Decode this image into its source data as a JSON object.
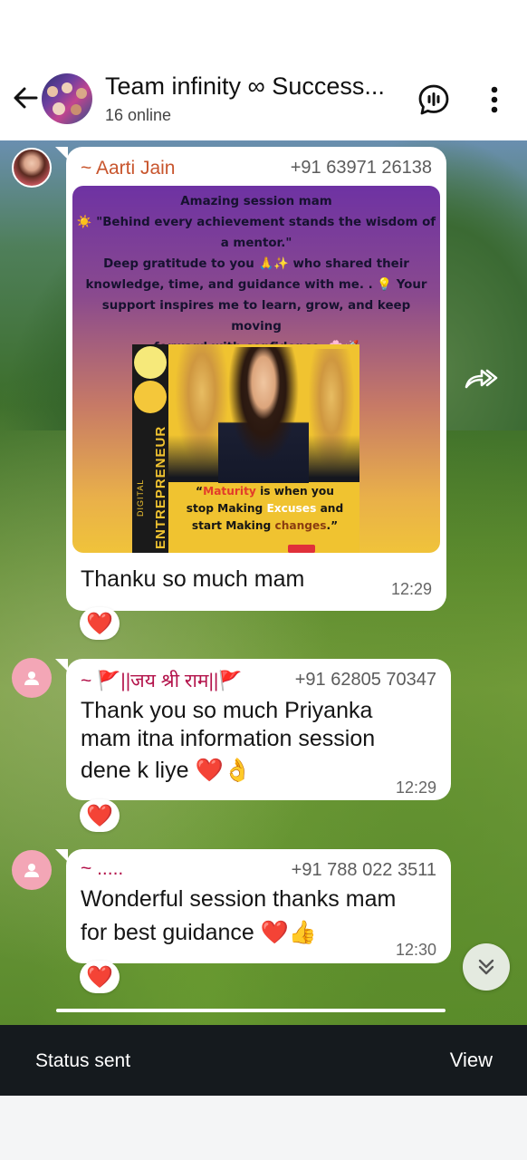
{
  "header": {
    "title": "Team infinity ∞ Success...",
    "subtitle": "16 online",
    "icons": {
      "back": "back-arrow-icon",
      "voice_chat": "voice-chat-icon",
      "menu": "more-vert-icon"
    }
  },
  "messages": [
    {
      "sender": "~ Aarti Jain",
      "sender_color": "#c8552d",
      "phone": "+91 63971 26138",
      "image_text": {
        "heading": "Amazing session mam",
        "line1": "☀️ \"Behind every achievement stands the wisdom of",
        "line2": "a mentor.\"",
        "line3": "Deep gratitude to you 🙏✨ who shared their",
        "line4": "knowledge, time, and guidance with me. . 💡 Your",
        "line5": "support inspires me to learn, grow, and keep moving",
        "line6": "forward with confidence. 🌸🚀"
      },
      "poster": {
        "vertical_big": "ENTREPRENEUR",
        "vertical_small": "DIGITAL",
        "quote_open": "“",
        "quote_red": "Maturity",
        "quote_1": " is when you",
        "quote_2a": "stop Making ",
        "quote_white": "Excuses",
        "quote_2b": " and",
        "quote_3a": "start Making ",
        "quote_brown": "changes",
        "quote_3b": ".”"
      },
      "text": "Thanku so much mam",
      "time": "12:29",
      "reaction": "❤️"
    },
    {
      "sender": "~ 🚩||जय श्री राम||🚩",
      "sender_color": "#b3124a",
      "phone": "+91 62805 70347",
      "text_line1": "Thank you so much Priyanka",
      "text_line2": "mam itna information session",
      "text_line3": "dene k liye ❤️👌",
      "time": "12:29",
      "reaction": "❤️"
    },
    {
      "sender": "~ .....",
      "sender_color": "#b3124a",
      "phone": "+91 788 022 3511",
      "text_line1": "Wonderful session thanks mam",
      "text_line2": "for best guidance ❤️👍",
      "time": "12:30",
      "reaction": "❤️"
    }
  ],
  "snackbar": {
    "message": "Status sent",
    "action": "View"
  }
}
